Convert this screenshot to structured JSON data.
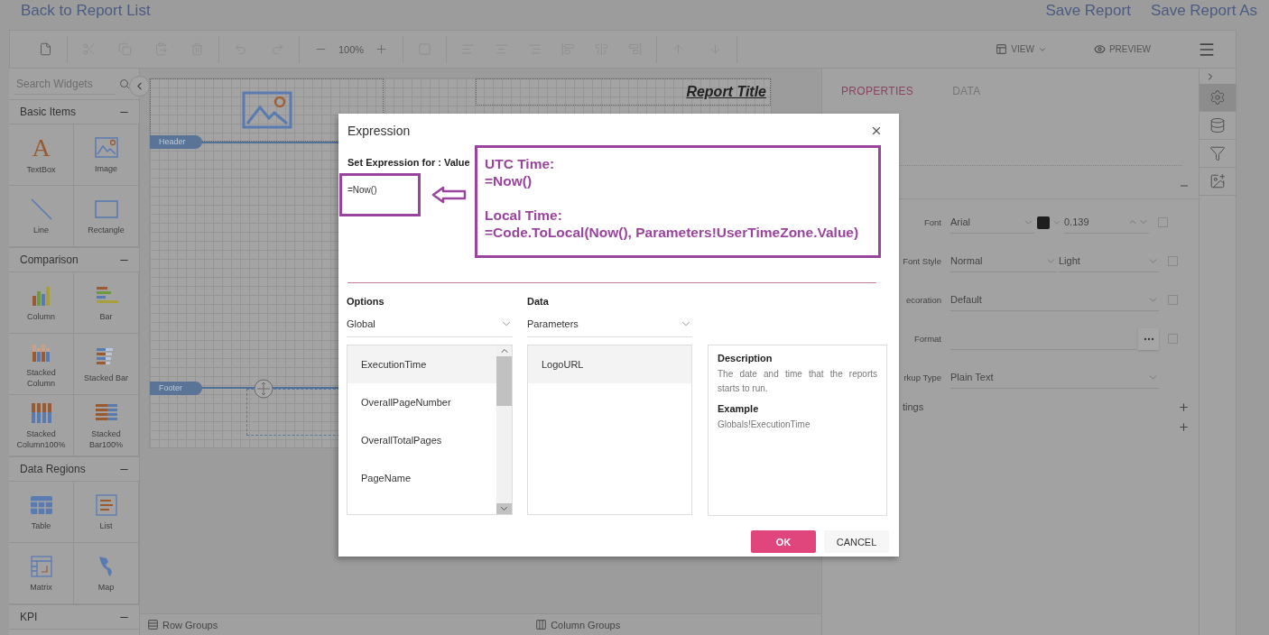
{
  "top_bar": {
    "back_link": "Back to Report List",
    "actions": [
      "Save Report",
      "Save Report As"
    ]
  },
  "toolbar": {
    "zoom": "100%",
    "view": "VIEW",
    "preview": "PREVIEW"
  },
  "widgets": {
    "search": {
      "placeholder": "Search Widgets"
    },
    "sections": [
      {
        "title": "Basic Items",
        "expanded": true,
        "items": [
          {
            "kind": "textbox",
            "glyph": "A",
            "label": "TextBox"
          },
          {
            "kind": "image",
            "label": "Image"
          },
          {
            "kind": "line",
            "label": "Line"
          },
          {
            "kind": "rectangle",
            "label": "Rectangle"
          }
        ]
      },
      {
        "title": "Comparison",
        "expanded": true,
        "items": [
          {
            "kind": "column",
            "label": "Column"
          },
          {
            "kind": "bar",
            "label": "Bar"
          },
          {
            "kind": "stacked-column",
            "label": "Stacked Column"
          },
          {
            "kind": "stacked-bar",
            "label": "Stacked Bar"
          },
          {
            "kind": "stacked-column-100",
            "label": "Stacked Column100%"
          },
          {
            "kind": "stacked-bar-100",
            "label": "Stacked Bar100%"
          }
        ]
      },
      {
        "title": "Data Regions",
        "expanded": true,
        "items": [
          {
            "kind": "table",
            "label": "Table"
          },
          {
            "kind": "list",
            "label": "List"
          },
          {
            "kind": "matrix",
            "label": "Matrix"
          },
          {
            "kind": "map",
            "label": "Map"
          }
        ]
      },
      {
        "title": "KPI",
        "expanded": true
      }
    ]
  },
  "canvas": {
    "header_label": "Header",
    "footer_label": "Footer",
    "report_title": "Report Title"
  },
  "group_bar": {
    "row_groups": "Row Groups",
    "column_groups": "Column Groups"
  },
  "properties": {
    "tabs": [
      {
        "label": "PROPERTIES",
        "selected": true
      },
      {
        "label": "DATA",
        "selected": false
      }
    ],
    "section": {
      "expanded": true
    },
    "rows": [
      {
        "kind": "font",
        "label": "Font",
        "family": "Arial",
        "color": "#1e1e1e",
        "size": "0.139",
        "checked": false
      },
      {
        "kind": "pair",
        "label": "Font Style",
        "first": "Normal",
        "second": "Light",
        "checked": false
      },
      {
        "kind": "select",
        "label": "ecoration",
        "value": "Default",
        "checked": false
      },
      {
        "kind": "format",
        "label": "Format",
        "checked": false
      },
      {
        "kind": "select",
        "label": "rkup Type",
        "value": "Plain Text"
      }
    ],
    "expanders": [
      {
        "label": "tings",
        "expanded": false
      },
      {
        "expanded": false
      }
    ]
  },
  "side_icons": [
    {
      "kind": "gear",
      "selected": true
    },
    {
      "kind": "database",
      "selected": false
    },
    {
      "kind": "filter",
      "selected": false
    },
    {
      "kind": "image",
      "selected": false
    }
  ],
  "dialog": {
    "title": "Expression",
    "expression_label": "Set Expression for : Value",
    "expression": "=Now()",
    "annotation": [
      {
        "heading": "UTC Time:",
        "code": "=Now()"
      },
      {
        "heading": "Local Time:",
        "code": "=Code.ToLocal(Now(), Parameters!UserTimeZone.Value)"
      }
    ],
    "options": {
      "label": "Options",
      "value": "Global",
      "items": [
        {
          "label": "ExecutionTime",
          "selected": true
        },
        {
          "label": "OverallPageNumber",
          "selected": false
        },
        {
          "label": "OverallTotalPages",
          "selected": false
        },
        {
          "label": "PageName",
          "selected": false
        }
      ]
    },
    "data": {
      "label": "Data",
      "value": "Parameters",
      "items": [
        {
          "label": "LogoURL",
          "selected": true
        }
      ]
    },
    "description": {
      "title": "Description",
      "text": "The date and time that the reports starts to run.",
      "example_title": "Example",
      "example": "Globals!ExecutionTime"
    },
    "buttons": [
      {
        "label": "OK",
        "kind": "primary"
      },
      {
        "label": "CANCEL",
        "kind": "secondary"
      }
    ]
  }
}
